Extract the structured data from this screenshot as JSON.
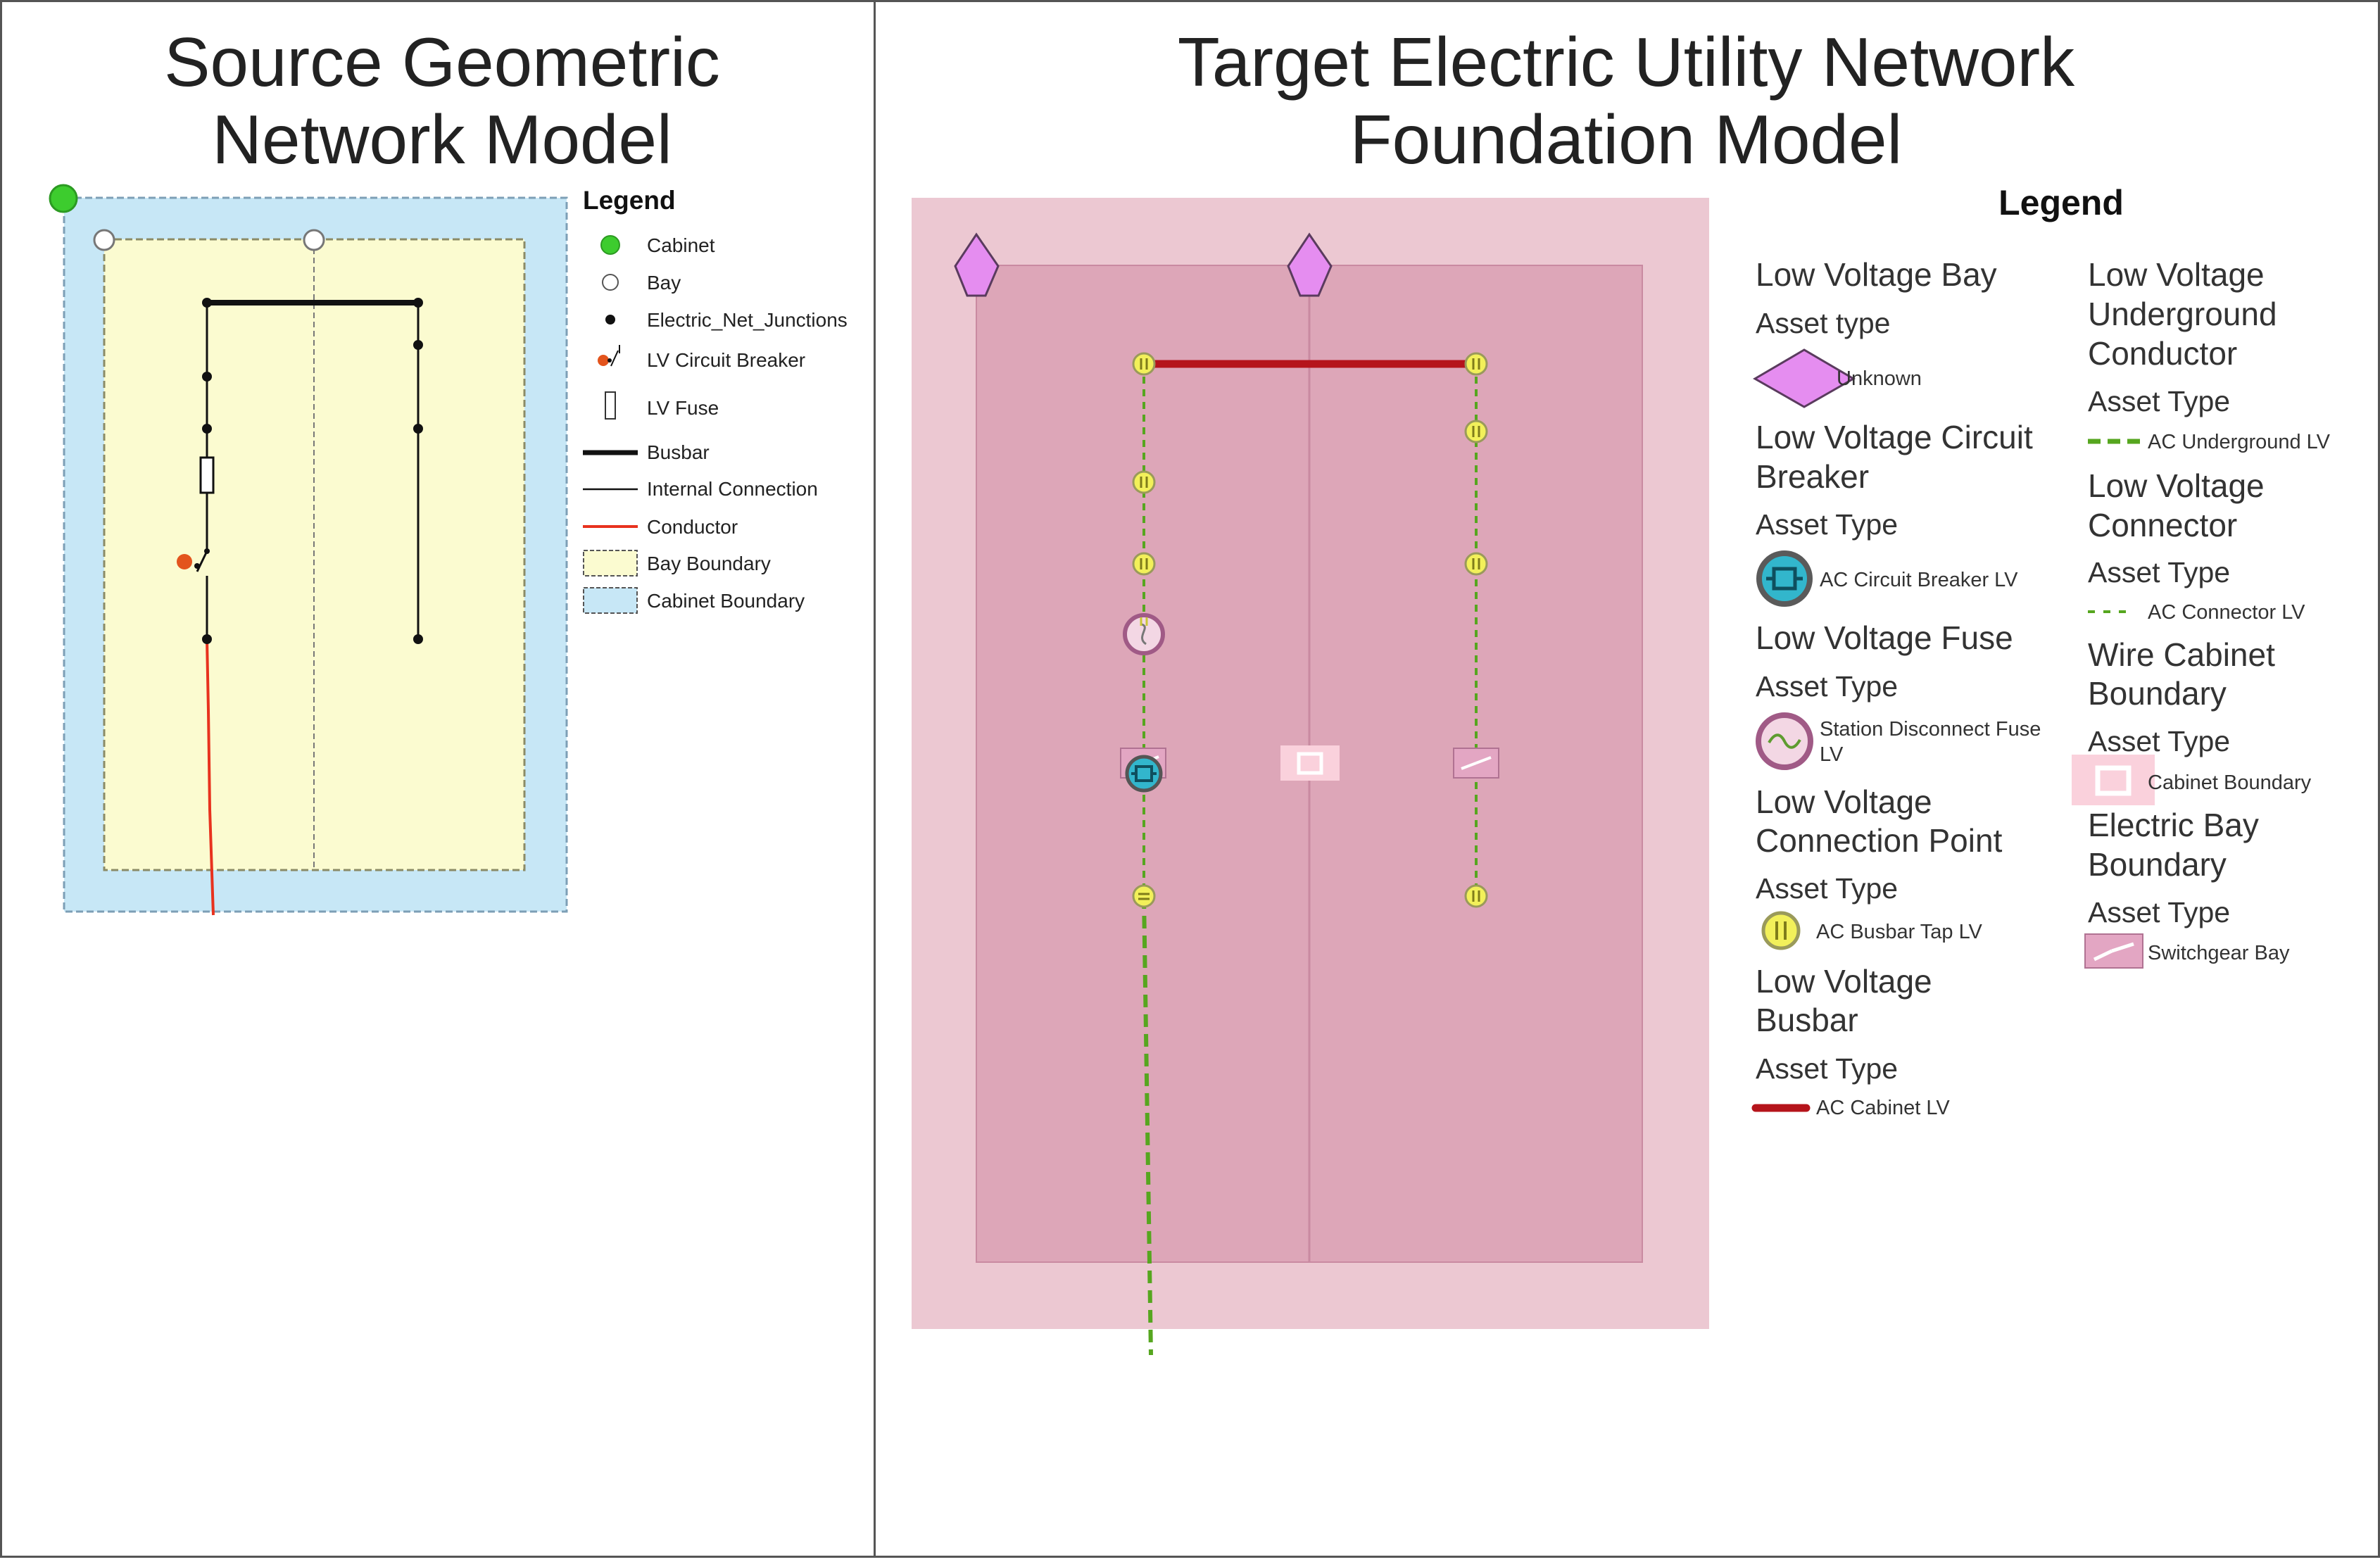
{
  "titles": {
    "source": [
      "Source Geometric",
      "Network Model"
    ],
    "target": [
      "Target Electric Utility Network",
      "Foundation Model"
    ]
  },
  "source_legend": {
    "heading": "Legend",
    "items": [
      {
        "icon": "cabinet-point-icon",
        "label": "Cabinet"
      },
      {
        "icon": "bay-point-icon",
        "label": "Bay"
      },
      {
        "icon": "junction-dot-icon",
        "label": "Electric_Net_Junctions"
      },
      {
        "icon": "lv-circuit-breaker-icon",
        "label": "LV Circuit Breaker"
      },
      {
        "icon": "lv-fuse-icon",
        "label": "LV Fuse"
      },
      {
        "icon": "busbar-line-icon",
        "label": "Busbar"
      },
      {
        "icon": "internal-connection-line-icon",
        "label": "Internal Connection"
      },
      {
        "icon": "conductor-line-icon",
        "label": "Conductor"
      },
      {
        "icon": "bay-boundary-swatch-icon",
        "label": "Bay Boundary"
      },
      {
        "icon": "cabinet-boundary-swatch-icon",
        "label": "Cabinet Boundary"
      }
    ]
  },
  "target_legend": {
    "heading": "Legend",
    "col1": {
      "lv_bay": {
        "title": "Low Voltage Bay",
        "asset_type": "Asset type",
        "value": "Unknown"
      },
      "lv_breaker": {
        "title": [
          "Low Voltage Circuit",
          "Breaker"
        ],
        "asset_type": "Asset Type",
        "value": "AC Circuit Breaker LV"
      },
      "lv_fuse": {
        "title": "Low Voltage Fuse",
        "asset_type": "Asset Type",
        "value": [
          "Station Disconnect Fuse",
          "LV"
        ]
      },
      "lv_connection_point": {
        "title": [
          "Low Voltage",
          "Connection Point"
        ],
        "asset_type": "Asset Type",
        "value": "AC Busbar Tap LV"
      },
      "lv_busbar": {
        "title": [
          "Low Voltage",
          "Busbar"
        ],
        "asset_type": "Asset Type",
        "value": "AC Cabinet LV"
      }
    },
    "col2": {
      "lv_ug_conductor": {
        "title": [
          "Low Voltage",
          "Underground",
          "Conductor"
        ],
        "asset_type": "Asset Type",
        "value": "AC Underground LV"
      },
      "lv_connector": {
        "title": [
          "Low Voltage",
          "Connector"
        ],
        "asset_type": "Asset Type",
        "value": "AC Connector LV"
      },
      "wire_cabinet_boundary": {
        "title": [
          "Wire Cabinet",
          "Boundary"
        ],
        "asset_type": "Asset Type",
        "value": "Cabinet Boundary"
      },
      "electric_bay_boundary": {
        "title": [
          "Electric Bay",
          "Boundary"
        ],
        "asset_type": "Asset Type",
        "value": "Switchgear Bay"
      }
    }
  },
  "colors": {
    "cabinet_green": "#3dcc2e",
    "bay_fill": "#fbfbd0",
    "cabinet_fill": "#c7e7f6",
    "conductor_red": "#e8321e",
    "breaker_orange": "#e3541d",
    "target_cabinet": "#ecc8d2",
    "target_bay": "#dda6b8",
    "lv_bay_magenta": "#e58df0",
    "busbar_darkred": "#b5141b",
    "conductor_green": "#56a61f",
    "tap_yellow": "#f2f05a",
    "breaker_teal": "#32b6cc"
  }
}
